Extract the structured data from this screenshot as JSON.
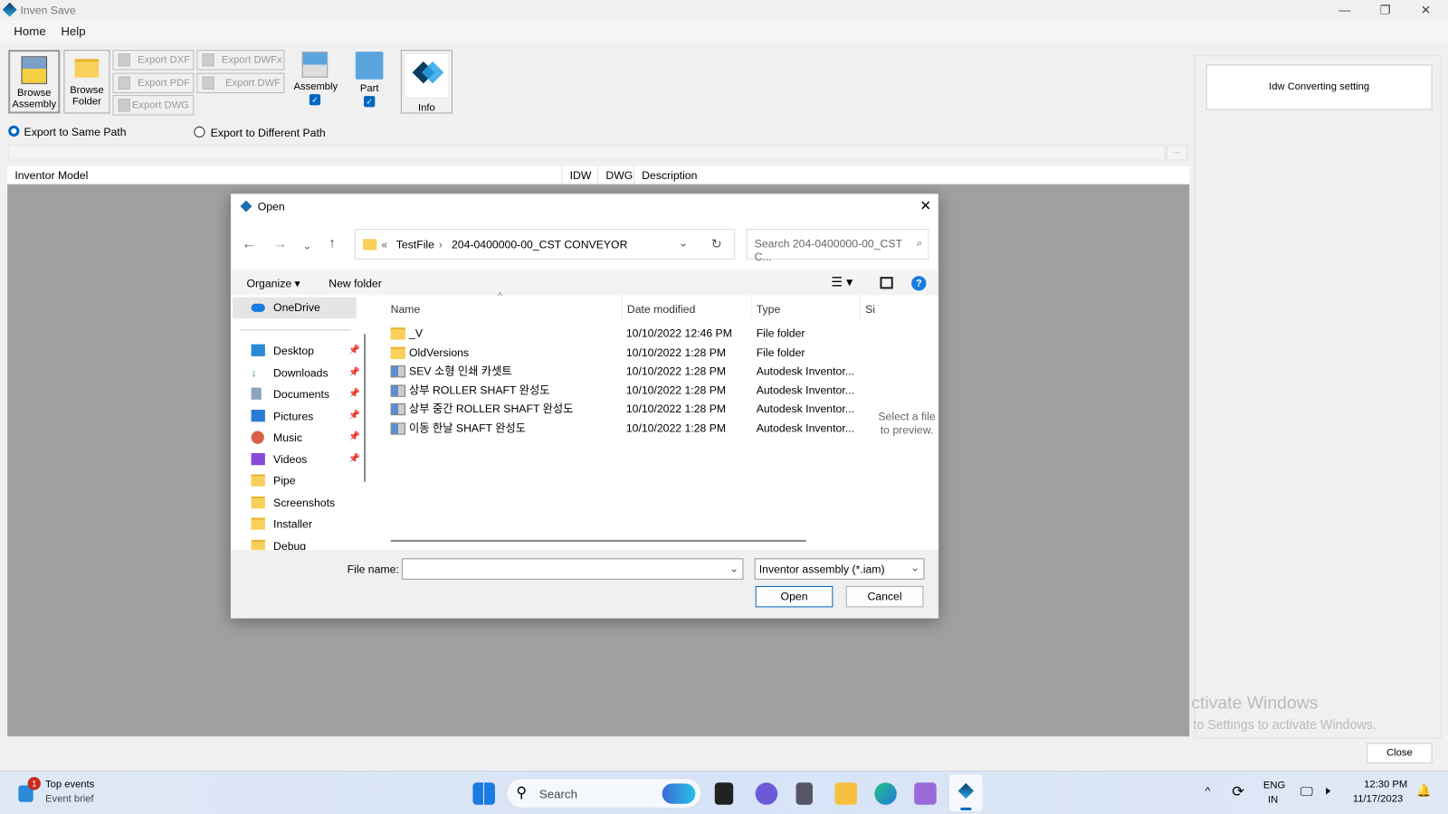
{
  "app": {
    "title": "Inven Save",
    "menu": [
      "Home",
      "Help"
    ]
  },
  "toolbar": {
    "browse_assembly": "Browse Assembly",
    "browse_folder": "Browse Folder",
    "export_dxf": "Export DXF",
    "export_dwfx": "Export DWFx",
    "export_pdf": "Export PDF",
    "export_dwf": "Export DWF",
    "export_dwg": "Export DWG",
    "assembly": "Assembly",
    "assembly_checked": true,
    "part": "Part",
    "part_checked": true,
    "info": "Info"
  },
  "options": {
    "same_path": "Export to Same Path",
    "different_path": "Export to Different Path",
    "selected": "same_path",
    "browse_ellipsis": "..."
  },
  "table": {
    "columns": [
      "Inventor Model",
      "IDW",
      "DWG",
      "Description"
    ]
  },
  "side_panel": {
    "idw_setting": "Idw Converting setting",
    "close": "Close"
  },
  "watermark": {
    "line1": "ctivate Windows",
    "line2": "to Settings to activate Windows."
  },
  "dialog": {
    "title": "Open",
    "breadcrumb": [
      "«",
      "TestFile",
      "204-0400000-00_CST CONVEYOR"
    ],
    "search_placeholder": "Search 204-0400000-00_CST C...",
    "organize": "Organize ▾",
    "new_folder": "New folder",
    "sidebar": [
      {
        "label": "OneDrive",
        "icon": "onedrive-icon",
        "pinned": false
      },
      {
        "label": "Desktop",
        "icon": "desktop-icon",
        "pinned": true
      },
      {
        "label": "Downloads",
        "icon": "downloads-icon",
        "pinned": true
      },
      {
        "label": "Documents",
        "icon": "documents-icon",
        "pinned": true
      },
      {
        "label": "Pictures",
        "icon": "pictures-icon",
        "pinned": true
      },
      {
        "label": "Music",
        "icon": "music-icon",
        "pinned": true
      },
      {
        "label": "Videos",
        "icon": "videos-icon",
        "pinned": true
      },
      {
        "label": "Pipe",
        "icon": "folder-icon",
        "pinned": false
      },
      {
        "label": "Screenshots",
        "icon": "folder-icon",
        "pinned": false
      },
      {
        "label": "Installer",
        "icon": "folder-icon",
        "pinned": false
      },
      {
        "label": "Debug",
        "icon": "folder-icon",
        "pinned": false
      }
    ],
    "columns": [
      "Name",
      "Date modified",
      "Type",
      "Si:"
    ],
    "files": [
      {
        "name": "_V",
        "date": "10/10/2022 12:46 PM",
        "type": "File folder",
        "kind": "folder"
      },
      {
        "name": "OldVersions",
        "date": "10/10/2022 1:28 PM",
        "type": "File folder",
        "kind": "folder"
      },
      {
        "name": "SEV 소형 인쇄 카셋트",
        "date": "10/10/2022 1:28 PM",
        "type": "Autodesk Inventor...",
        "kind": "iam"
      },
      {
        "name": "상부 ROLLER SHAFT 완성도",
        "date": "10/10/2022 1:28 PM",
        "type": "Autodesk Inventor...",
        "kind": "iam"
      },
      {
        "name": "상부 중간 ROLLER SHAFT 완성도",
        "date": "10/10/2022 1:28 PM",
        "type": "Autodesk Inventor...",
        "kind": "iam"
      },
      {
        "name": "이동 한날 SHAFT 완성도",
        "date": "10/10/2022 1:28 PM",
        "type": "Autodesk Inventor...",
        "kind": "iam"
      }
    ],
    "preview": "Select a file to preview.",
    "file_name_label": "File name:",
    "file_name_value": "",
    "filter": "Inventor assembly (*.iam)",
    "open": "Open",
    "cancel": "Cancel"
  },
  "taskbar": {
    "widget_title": "Top events",
    "widget_sub": "Event brief",
    "badge": "1",
    "search": "Search",
    "lang1": "ENG",
    "lang2": "IN",
    "time": "12:30 PM",
    "date": "11/17/2023"
  },
  "colors": {
    "accent": "#0067c0",
    "workspace": "#a0a0a0"
  }
}
